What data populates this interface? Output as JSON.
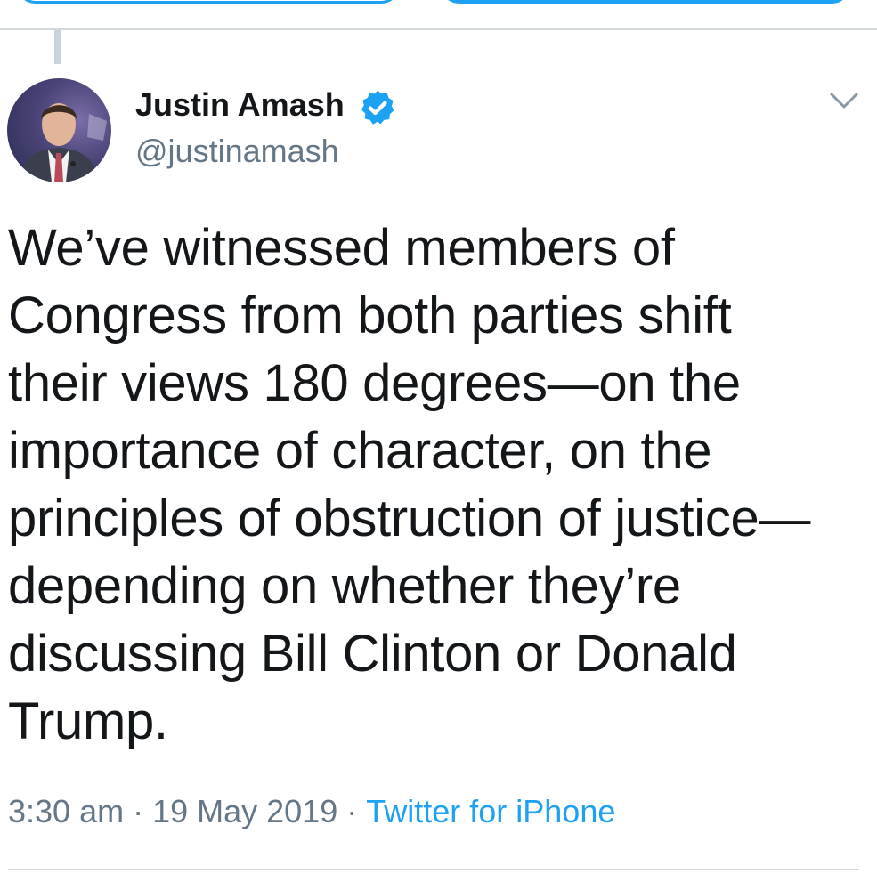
{
  "tweet": {
    "display_name": "Justin Amash",
    "handle": "@justinamash",
    "verified": true,
    "text": "We’ve witnessed members of\nCongress from both parties shift\ntheir views 180 degrees—on the\nimportance of character, on the\nprinciples of obstruction of justice—\ndepending on whether they’re\ndiscussing Bill Clinton or Donald\nTrump.",
    "time": "3:30 am",
    "separator": "·",
    "date": "19 May 2019",
    "source": "Twitter for iPhone"
  },
  "icons": {
    "verified": "verified-badge-icon",
    "menu": "chevron-down-icon"
  },
  "colors": {
    "accent": "#1da1f2",
    "text": "#14171a",
    "muted": "#657786",
    "divider": "#d3d8dc"
  }
}
